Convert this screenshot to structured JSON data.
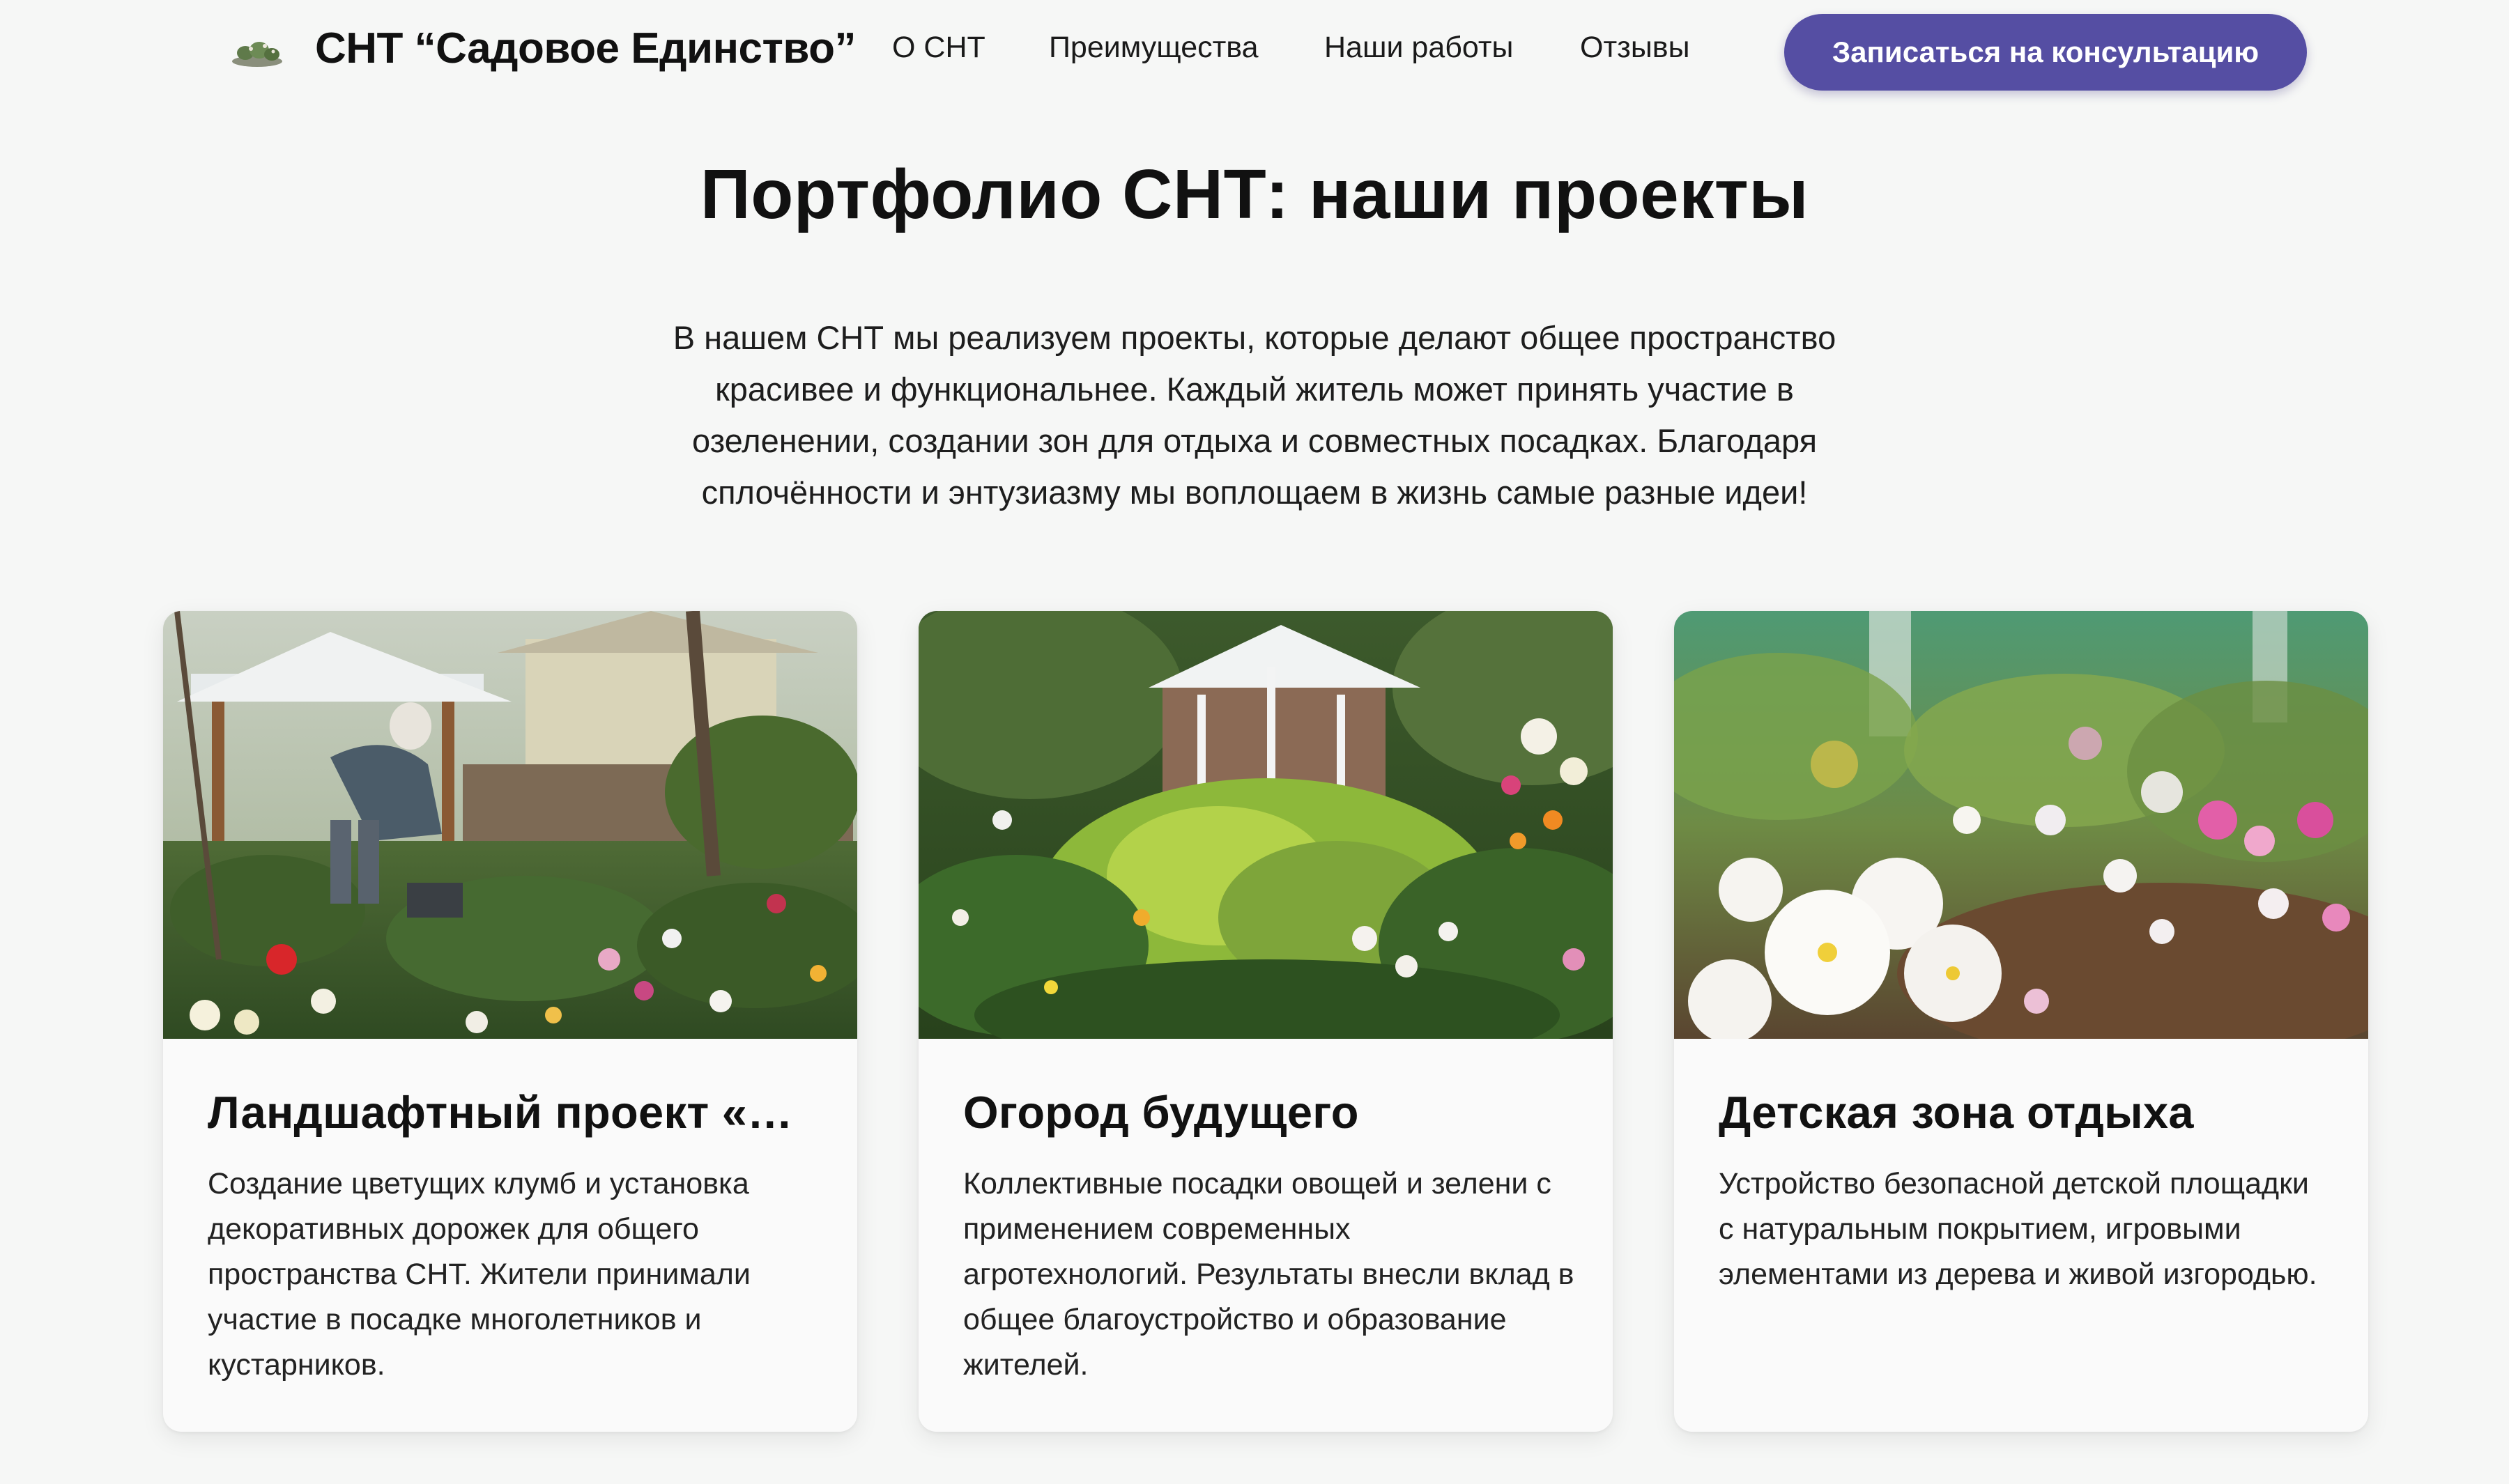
{
  "header": {
    "logo_icon": "garden-logo-icon",
    "brand": "СНТ “Садовое Единство”",
    "nav": [
      "О СНТ",
      "Преимущества",
      "Наши работы",
      "Отзывы"
    ],
    "cta_label": "Записаться на консультацию"
  },
  "main": {
    "title": "Портфолио СНТ: наши проекты",
    "intro": "В нашем СНТ мы реализуем проекты, которые делают общее пространство красивее и функциональнее. Каждый житель может принять участие в озеленении, создании зон для отдыха и совместных посадках. Благодаря сплочённости и энтузиазму мы воплощаем в жизнь самые разные идеи!"
  },
  "cards": [
    {
      "title": "Ландшафтный проект «…",
      "text": "Создание цветущих клумб и установка декоративных дорожек для общего пространства СНТ. Жители принимали участие в посадке многолетников и кустарников."
    },
    {
      "title": "Огород будущего",
      "text": "Коллективные посадки овощей и зелени с применением современных агротехнологий. Результаты внесли вклад в общее благоустройство и образование жителей."
    },
    {
      "title": "Детская зона отдыха",
      "text": "Устройство безопасной детской площадки с натуральным покрытием, игровыми элементами из дерева и живой изгородью."
    }
  ]
}
